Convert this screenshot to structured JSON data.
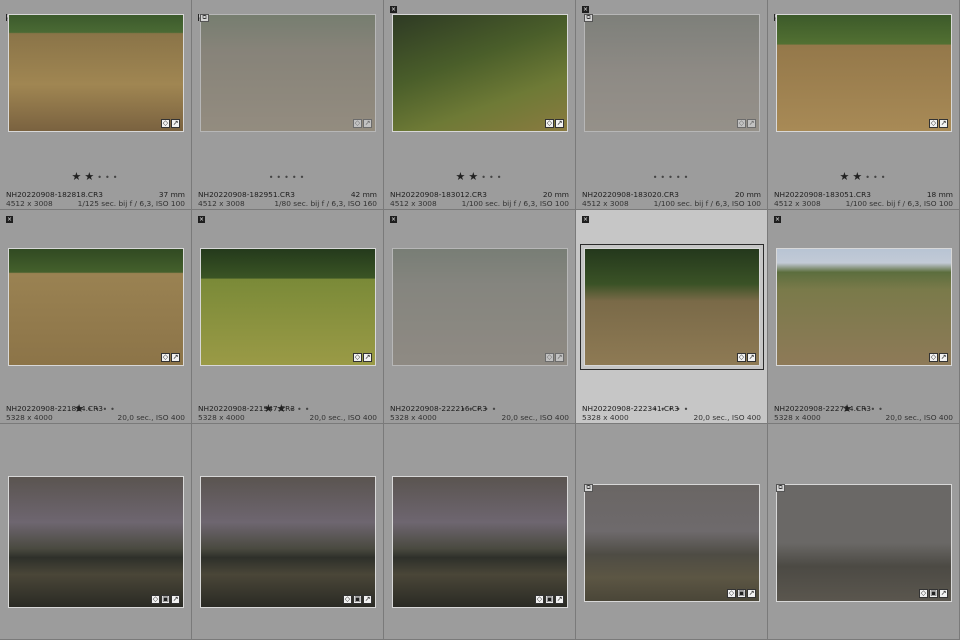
{
  "colors": {
    "cell_bg": "#9c9c9c",
    "selected_bg": "#c6c6c6",
    "grid_line": "#7a7a7a"
  },
  "rows": [
    {
      "cells": [
        {
          "filename": "NH20220908-182818.CR3",
          "focal": "37 mm",
          "dims": "4512 x 3008",
          "exposure": "1/125 sec. bij f / 6,3, ISO 100",
          "stars": 2,
          "dimmed": false,
          "selected": false,
          "scene": "dog-single-sunlit",
          "flag": "white-flag-icon",
          "stacked": false
        },
        {
          "filename": "NH20220908-182951.CR3",
          "focal": "42 mm",
          "dims": "4512 x 3008",
          "exposure": "1/80 sec. bij f / 6,3, ISO 160",
          "stars": 0,
          "dimmed": true,
          "selected": false,
          "scene": "dog-single-dim",
          "flag": "white-flag-icon",
          "stacked": true
        },
        {
          "filename": "NH20220908-183012.CR3",
          "focal": "20 mm",
          "dims": "4512 x 3008",
          "exposure": "1/100 sec. bij f / 6,3, ISO 100",
          "stars": 2,
          "dimmed": false,
          "selected": false,
          "scene": "dog-portrait",
          "flag": "reject-icon",
          "stacked": false
        },
        {
          "filename": "NH20220908-183020.CR3",
          "focal": "20 mm",
          "dims": "4512 x 3008",
          "exposure": "1/100 sec. bij f / 6,3, ISO 100",
          "stars": 0,
          "dimmed": true,
          "selected": false,
          "scene": "two-dogs-dim",
          "flag": "reject-icon",
          "stacked": true
        },
        {
          "filename": "NH20220908-183051.CR3",
          "focal": "18 mm",
          "dims": "4512 x 3008",
          "exposure": "1/100 sec. bij f / 6,3, ISO 100",
          "stars": 2,
          "dimmed": false,
          "selected": false,
          "scene": "two-dogs",
          "flag": "white-flag-icon",
          "stacked": false
        }
      ]
    },
    {
      "cells": [
        {
          "filename": "NH20220908-221824.CR3",
          "focal": "",
          "dims": "5328 x 4000",
          "exposure": "20,0 sec., ISO 400",
          "stars": 1,
          "dimmed": false,
          "selected": false,
          "scene": "dogs-field",
          "flag": "reject-icon",
          "stacked": false
        },
        {
          "filename": "NH20220908-221947.CR3",
          "focal": "",
          "dims": "5328 x 4000",
          "exposure": "20,0 sec., ISO 400",
          "stars": 2,
          "dimmed": false,
          "selected": false,
          "scene": "dogs-playing",
          "flag": "reject-icon",
          "stacked": false
        },
        {
          "filename": "NH20220908-222216.CR3",
          "focal": "",
          "dims": "5328 x 4000",
          "exposure": "20,0 sec., ISO 400",
          "stars": 0,
          "dimmed": true,
          "selected": false,
          "scene": "dogs-dim",
          "flag": "reject-icon",
          "stacked": false
        },
        {
          "filename": "NH20220908-222341.CR3",
          "focal": "",
          "dims": "5328 x 4000",
          "exposure": "20,0 sec., ISO 400",
          "stars": 0,
          "dimmed": false,
          "selected": true,
          "scene": "dogs-faceoff",
          "flag": "reject-icon",
          "stacked": false
        },
        {
          "filename": "NH20220908-222724.CR3",
          "focal": "",
          "dims": "5328 x 4000",
          "exposure": "20,0 sec., ISO 400",
          "stars": 1,
          "dimmed": false,
          "selected": false,
          "scene": "dog-jump",
          "flag": "reject-icon",
          "stacked": false
        }
      ]
    },
    {
      "cells": [
        {
          "filename": "",
          "focal": "",
          "dims": "",
          "exposure": "",
          "stars": 0,
          "dimmed": false,
          "selected": false,
          "scene": "night-lake",
          "flag": "",
          "stacked": false
        },
        {
          "filename": "",
          "focal": "",
          "dims": "",
          "exposure": "",
          "stars": 0,
          "dimmed": false,
          "selected": false,
          "scene": "night-lake",
          "flag": "",
          "stacked": false
        },
        {
          "filename": "",
          "focal": "",
          "dims": "",
          "exposure": "",
          "stars": 0,
          "dimmed": false,
          "selected": false,
          "scene": "night-lake",
          "flag": "",
          "stacked": false
        },
        {
          "filename": "",
          "focal": "",
          "dims": "",
          "exposure": "",
          "stars": 0,
          "dimmed": false,
          "selected": false,
          "scene": "night-lake-dim",
          "flag": "",
          "stacked": true
        },
        {
          "filename": "",
          "focal": "",
          "dims": "",
          "exposure": "",
          "stars": 0,
          "dimmed": false,
          "selected": false,
          "scene": "night-lake-dark",
          "flag": "",
          "stacked": true
        }
      ]
    }
  ]
}
